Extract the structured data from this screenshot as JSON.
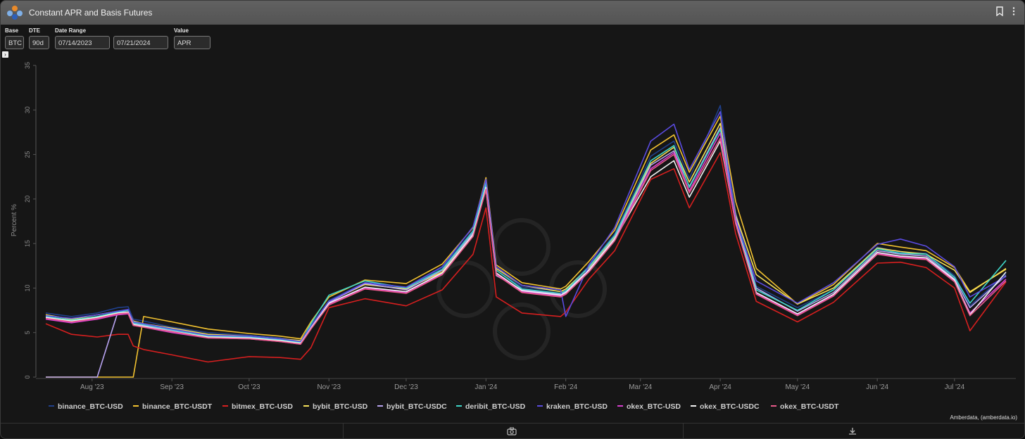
{
  "window": {
    "title": "Constant APR and Basis Futures",
    "credit": "Amberdata, (amberdata.io)"
  },
  "icons": {
    "logo": "amberdata-logo-icon",
    "bookmark": "bookmark-icon",
    "menu": "more-vertical-icon",
    "expand": "chevron-right-icon",
    "camera": "camera-icon",
    "download": "download-icon"
  },
  "controls": {
    "base": {
      "label": "Base",
      "value": "BTC"
    },
    "dte": {
      "label": "DTE",
      "value": "90d"
    },
    "date_range": {
      "label": "Date Range",
      "start": "07/14/2023",
      "end": "07/21/2024"
    },
    "value": {
      "label": "Value",
      "value": "APR"
    }
  },
  "chart_data": {
    "type": "line",
    "title": "",
    "xlabel": "",
    "ylabel": "Percent %",
    "ylim": [
      0,
      35
    ],
    "yticks": [
      0,
      5,
      10,
      15,
      20,
      25,
      30,
      35
    ],
    "xticks": [
      {
        "label": "Aug '23",
        "date": "2023-08-01"
      },
      {
        "label": "Sep '23",
        "date": "2023-09-01"
      },
      {
        "label": "Oct '23",
        "date": "2023-10-01"
      },
      {
        "label": "Nov '23",
        "date": "2023-11-01"
      },
      {
        "label": "Dec '23",
        "date": "2023-12-01"
      },
      {
        "label": "Jan '24",
        "date": "2024-01-01"
      },
      {
        "label": "Feb '24",
        "date": "2024-02-01"
      },
      {
        "label": "Mar '24",
        "date": "2024-03-01"
      },
      {
        "label": "Apr '24",
        "date": "2024-04-01"
      },
      {
        "label": "May '24",
        "date": "2024-05-01"
      },
      {
        "label": "Jun '24",
        "date": "2024-06-01"
      },
      {
        "label": "Jul '24",
        "date": "2024-07-01"
      }
    ],
    "grid": false,
    "legend_position": "bottom",
    "x": [
      "2023-07-14",
      "2023-07-24",
      "2023-08-03",
      "2023-08-11",
      "2023-08-15",
      "2023-08-17",
      "2023-08-21",
      "2023-09-01",
      "2023-09-15",
      "2023-10-01",
      "2023-10-13",
      "2023-10-21",
      "2023-10-25",
      "2023-11-01",
      "2023-11-15",
      "2023-12-01",
      "2023-12-15",
      "2023-12-27",
      "2024-01-01",
      "2024-01-05",
      "2024-01-15",
      "2024-01-30",
      "2024-02-01",
      "2024-02-10",
      "2024-02-20",
      "2024-03-05",
      "2024-03-14",
      "2024-03-20",
      "2024-04-01",
      "2024-04-07",
      "2024-04-15",
      "2024-05-01",
      "2024-05-15",
      "2024-06-01",
      "2024-06-10",
      "2024-06-20",
      "2024-07-01",
      "2024-07-07",
      "2024-07-21"
    ],
    "series": [
      {
        "name": "binance_BTC-USD",
        "color": "#1f3f8a",
        "values": [
          7.2,
          6.8,
          7.2,
          7.8,
          7.9,
          6.5,
          6.3,
          5.6,
          5.0,
          4.7,
          4.4,
          4.0,
          5.8,
          8.6,
          10.6,
          10.0,
          12.3,
          16.5,
          22.0,
          12.0,
          10.1,
          9.6,
          9.8,
          12.5,
          16.1,
          24.8,
          26.5,
          22.3,
          30.5,
          18.5,
          10.2,
          7.8,
          9.8,
          14.6,
          14.0,
          13.9,
          11.4,
          8.0,
          11.6
        ]
      },
      {
        "name": "binance_BTC-USDT",
        "color": "#f2c230",
        "values": [
          0.0,
          0.0,
          0.0,
          0.0,
          0.0,
          0.0,
          6.8,
          6.2,
          5.4,
          4.9,
          4.6,
          4.3,
          6.2,
          9.0,
          10.9,
          10.5,
          12.7,
          16.8,
          22.4,
          12.6,
          10.6,
          9.9,
          10.2,
          13.0,
          16.5,
          25.5,
          27.2,
          23.0,
          29.3,
          19.7,
          12.2,
          8.2,
          10.4,
          15.0,
          14.6,
          14.2,
          12.3,
          9.6,
          12.1
        ]
      },
      {
        "name": "bitmex_BTC-USD",
        "color": "#d61f1f",
        "values": [
          6.0,
          4.8,
          4.5,
          4.8,
          4.8,
          3.5,
          3.1,
          2.5,
          1.7,
          2.3,
          2.2,
          2.0,
          3.3,
          7.8,
          8.8,
          8.0,
          9.8,
          13.8,
          19.0,
          9.0,
          7.2,
          6.8,
          7.3,
          11.0,
          14.2,
          22.2,
          23.4,
          19.0,
          25.2,
          16.1,
          8.5,
          6.2,
          8.4,
          12.8,
          12.9,
          12.3,
          10.0,
          5.2,
          10.7
        ]
      },
      {
        "name": "bybit_BTC-USD",
        "color": "#f5e15a",
        "values": [
          7.0,
          6.5,
          7.0,
          7.4,
          7.5,
          6.3,
          6.0,
          5.5,
          4.8,
          4.6,
          4.3,
          4.1,
          5.7,
          8.5,
          10.4,
          9.9,
          11.8,
          16.0,
          21.5,
          12.2,
          10.3,
          9.6,
          9.9,
          12.3,
          15.8,
          24.0,
          25.8,
          21.9,
          28.5,
          18.2,
          11.5,
          8.2,
          10.0,
          14.5,
          14.1,
          13.8,
          12.0,
          9.5,
          12.2
        ]
      },
      {
        "name": "bybit_BTC-USDC",
        "color": "#b8a3f0",
        "values": [
          0.0,
          0.0,
          0.0,
          7.3,
          7.3,
          6.0,
          5.8,
          5.2,
          4.6,
          4.4,
          4.1,
          3.8,
          5.6,
          8.4,
          10.5,
          9.8,
          12.0,
          16.2,
          21.0,
          11.4,
          9.8,
          9.3,
          9.6,
          12.1,
          15.6,
          23.8,
          25.4,
          21.4,
          28.0,
          18.0,
          10.0,
          7.4,
          9.5,
          14.2,
          13.8,
          13.6,
          11.0,
          7.8,
          11.4
        ]
      },
      {
        "name": "deribit_BTC-USD",
        "color": "#3ed6c8",
        "values": [
          6.8,
          6.4,
          6.8,
          7.3,
          7.5,
          6.1,
          5.9,
          5.3,
          4.6,
          4.5,
          4.2,
          3.9,
          6.0,
          9.2,
          10.8,
          10.0,
          12.1,
          16.4,
          21.8,
          12.0,
          9.9,
          9.4,
          9.7,
          12.4,
          15.9,
          24.3,
          26.0,
          21.3,
          27.8,
          17.6,
          9.8,
          7.5,
          9.8,
          14.4,
          13.9,
          13.8,
          11.2,
          8.3,
          13.1
        ]
      },
      {
        "name": "kraken_BTC-USD",
        "color": "#5a4be0",
        "values": [
          6.9,
          6.6,
          7.0,
          7.4,
          7.6,
          6.2,
          6.0,
          5.4,
          4.7,
          4.6,
          4.3,
          4.0,
          5.7,
          8.5,
          10.6,
          10.1,
          12.4,
          16.9,
          22.2,
          12.4,
          10.3,
          9.8,
          6.8,
          12.6,
          16.8,
          26.5,
          28.4,
          23.3,
          29.8,
          17.7,
          10.8,
          8.3,
          10.6,
          14.9,
          15.5,
          14.7,
          12.4,
          9.0,
          11.3
        ]
      },
      {
        "name": "okex_BTC-USD",
        "color": "#d83fd0",
        "values": [
          6.5,
          6.1,
          6.5,
          7.0,
          7.1,
          5.8,
          5.6,
          5.0,
          4.4,
          4.3,
          4.0,
          3.7,
          5.4,
          8.2,
          10.0,
          9.5,
          11.6,
          15.9,
          21.2,
          11.6,
          9.6,
          9.1,
          9.4,
          11.9,
          15.4,
          23.4,
          25.2,
          20.9,
          27.4,
          17.4,
          9.4,
          7.0,
          9.2,
          13.9,
          13.5,
          13.3,
          10.8,
          7.2,
          11.0
        ]
      },
      {
        "name": "okex_BTC-USDC",
        "color": "#f2f2f2",
        "values": [
          6.7,
          6.3,
          6.7,
          7.2,
          7.3,
          5.9,
          5.7,
          5.1,
          4.5,
          4.4,
          4.1,
          3.8,
          5.5,
          8.3,
          10.1,
          9.6,
          11.7,
          16.0,
          21.3,
          11.7,
          9.7,
          9.2,
          9.5,
          12.0,
          15.5,
          22.5,
          24.3,
          20.2,
          26.5,
          17.3,
          9.5,
          7.1,
          9.3,
          14.0,
          13.6,
          13.4,
          10.9,
          7.0,
          11.8
        ]
      },
      {
        "name": "okex_BTC-USDT",
        "color": "#e85a8a",
        "values": [
          6.6,
          6.2,
          6.6,
          7.1,
          7.2,
          5.8,
          5.6,
          5.1,
          4.4,
          4.3,
          4.0,
          3.7,
          5.4,
          8.1,
          9.9,
          9.4,
          11.5,
          15.8,
          21.1,
          11.5,
          9.5,
          9.0,
          9.3,
          11.8,
          15.3,
          23.2,
          25.0,
          20.7,
          26.8,
          17.2,
          9.3,
          6.9,
          9.1,
          13.8,
          13.4,
          13.2,
          10.7,
          6.9,
          10.8
        ]
      }
    ]
  }
}
